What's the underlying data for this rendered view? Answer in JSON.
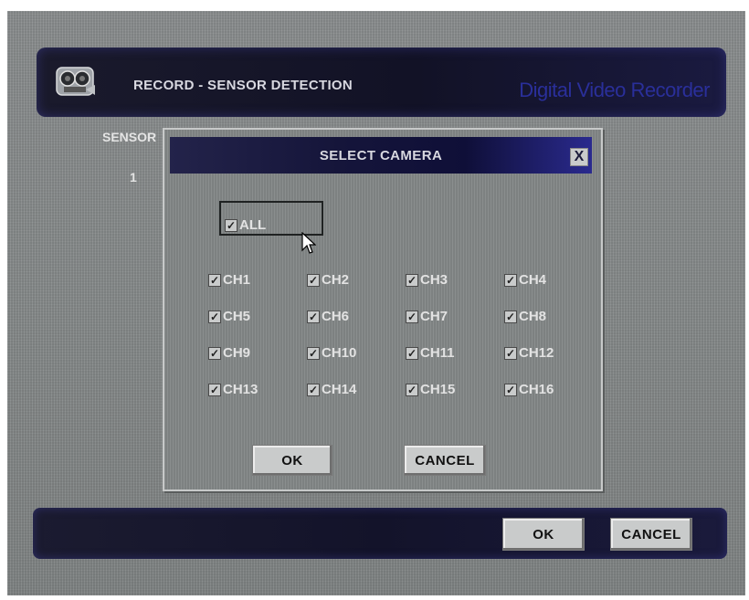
{
  "header": {
    "title": "RECORD - SENSOR DETECTION",
    "brand": "Digital Video Recorder",
    "icon": "camera-icon"
  },
  "background": {
    "sensor_label": "SENSOR",
    "sensor_number": "1"
  },
  "footer": {
    "ok_label": "OK",
    "cancel_label": "CANCEL"
  },
  "dialog": {
    "title": "SELECT CAMERA",
    "close_label": "X",
    "all": {
      "label": "ALL",
      "checked": true
    },
    "channels": [
      {
        "label": "CH1",
        "checked": true
      },
      {
        "label": "CH2",
        "checked": true
      },
      {
        "label": "CH3",
        "checked": true
      },
      {
        "label": "CH4",
        "checked": true
      },
      {
        "label": "CH5",
        "checked": true
      },
      {
        "label": "CH6",
        "checked": true
      },
      {
        "label": "CH7",
        "checked": true
      },
      {
        "label": "CH8",
        "checked": true
      },
      {
        "label": "CH9",
        "checked": true
      },
      {
        "label": "CH10",
        "checked": true
      },
      {
        "label": "CH11",
        "checked": true
      },
      {
        "label": "CH12",
        "checked": true
      },
      {
        "label": "CH13",
        "checked": true
      },
      {
        "label": "CH14",
        "checked": true
      },
      {
        "label": "CH15",
        "checked": true
      },
      {
        "label": "CH16",
        "checked": true
      }
    ],
    "ok_label": "OK",
    "cancel_label": "CANCEL"
  },
  "colors": {
    "bar_dark": "#13132a",
    "accent_blue": "#2a2f9a",
    "button_bg": "#c9cbcb",
    "label_text": "#e2e2e2"
  }
}
